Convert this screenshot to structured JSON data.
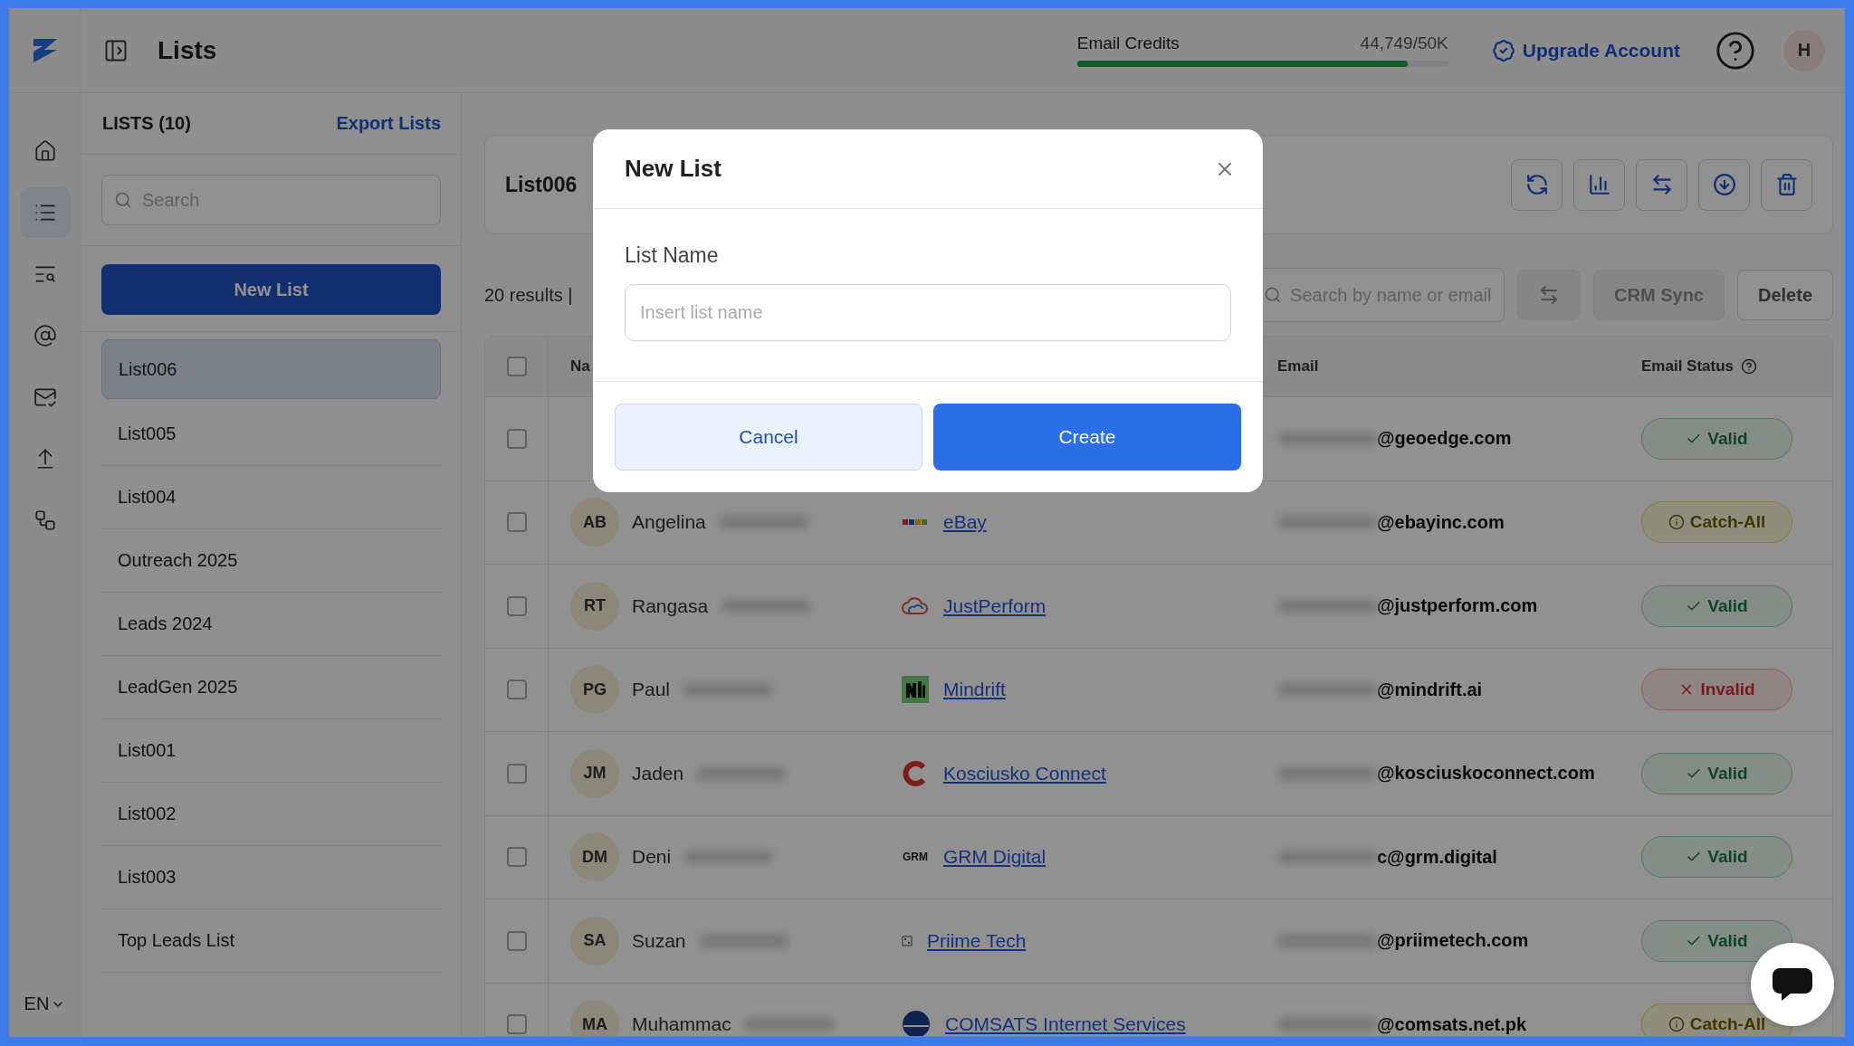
{
  "header": {
    "title": "Lists",
    "credits": {
      "label": "Email Credits",
      "value": "44,749/50K",
      "level": 0.89
    },
    "upgrade": "Upgrade Account",
    "avatar": "H"
  },
  "rail": {
    "items": [
      {
        "selected": false
      },
      {
        "selected": true
      },
      {
        "selected": false
      },
      {
        "selected": false
      },
      {
        "selected": false
      },
      {
        "selected": false
      },
      {
        "selected": false
      }
    ],
    "language": "EN"
  },
  "lists_panel": {
    "title": "LISTS (10)",
    "export": "Export Lists",
    "search": {
      "placeholder": "Search"
    },
    "new_button": "New List",
    "items": [
      {
        "label": "List006",
        "selected": true
      },
      {
        "label": "List005",
        "selected": false
      },
      {
        "label": "List004",
        "selected": false
      },
      {
        "label": "Outreach 2025",
        "selected": false
      },
      {
        "label": "Leads 2024",
        "selected": false
      },
      {
        "label": "LeadGen 2025",
        "selected": false
      },
      {
        "label": "List001",
        "selected": false
      },
      {
        "label": "List002",
        "selected": false
      },
      {
        "label": "List003",
        "selected": false
      },
      {
        "label": "Top Leads List",
        "selected": false
      }
    ]
  },
  "main": {
    "list_title": "List006",
    "results": "20 results |",
    "search": {
      "placeholder": "Search by name or email"
    },
    "crm_sync": {
      "label": "CRM Sync",
      "disabled": true
    },
    "delete": {
      "label": "Delete",
      "disabled": false
    }
  },
  "table": {
    "select_all": {
      "checked": false
    },
    "columns": [
      "Na",
      "Email",
      "Email Status"
    ],
    "rows": [
      {
        "checked": false,
        "email_domain": "@geoedge.com",
        "status": "Valid",
        "kind": "valid"
      },
      {
        "checked": false,
        "initials": "AB",
        "first_name": "Angelina",
        "company": "eBay",
        "email_domain": "@ebayinc.com",
        "status": "Catch-All",
        "kind": "catch_all"
      },
      {
        "checked": false,
        "initials": "RT",
        "first_name": "Rangasa",
        "company": "JustPerform",
        "email_domain": "@justperform.com",
        "status": "Valid",
        "kind": "valid"
      },
      {
        "checked": false,
        "initials": "PG",
        "first_name": "Paul",
        "company": "Mindrift",
        "email_domain": "@mindrift.ai",
        "status": "Invalid",
        "kind": "invalid"
      },
      {
        "checked": false,
        "initials": "JM",
        "first_name": "Jaden",
        "company": "Kosciusko Connect",
        "email_domain": "@kosciuskoconnect.com",
        "status": "Valid",
        "kind": "valid"
      },
      {
        "checked": false,
        "initials": "DM",
        "first_name": "Deni",
        "company": "GRM Digital",
        "logo_text": "GRM",
        "email_domain": "c@grm.digital",
        "status": "Valid",
        "kind": "valid"
      },
      {
        "checked": false,
        "initials": "SA",
        "first_name": "Suzan",
        "company": "Priime Tech",
        "email_domain": "@priimetech.com",
        "status": "Valid",
        "kind": "valid"
      },
      {
        "checked": false,
        "initials": "MA",
        "first_name": "Muhammac",
        "company": "COMSATS Internet Services",
        "email_domain": "@comsats.net.pk",
        "status": "Catch-All",
        "kind": "catch_all"
      }
    ]
  },
  "modal": {
    "title": "New List",
    "label": "List Name",
    "placeholder": "Insert list name",
    "cancel": "Cancel",
    "create": "Create"
  }
}
